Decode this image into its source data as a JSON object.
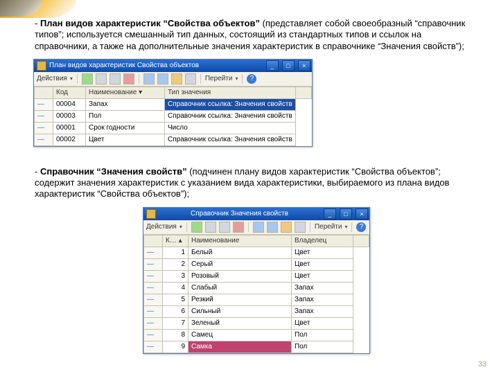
{
  "slide": {
    "para1_bold": "План видов характеристик “Свойства объектов”",
    "para1_rest": " (представляет собой своеобразный “справочник типов”; используется смешанный тип данных, состоящий из стандартных типов и ссылок на справочники, а также на дополнительные значения характеристик в справочнике “Значения свойств”);",
    "para2_bold": "Справочник “Значения свойств”",
    "para2_rest": " (подчинен плану видов характеристик “Свойства объектов”; содержит значения характеристик с указанием вида характеристики, выбираемого из плана видов характеристик “Свойства объектов”);",
    "page_number": "33"
  },
  "win1": {
    "title": "План видов характеристик Свойства объектов",
    "actions": "Действия",
    "jump": "Перейти",
    "help": "?",
    "cols": {
      "c0": "",
      "c1": "Код",
      "c2": "Наименование",
      "c3": "Тип значения"
    },
    "rows": [
      {
        "mark": "",
        "code": "00004",
        "name": "Запах",
        "type": "Справочник ссылка: Значения свойств",
        "sel": true
      },
      {
        "mark": "",
        "code": "00003",
        "name": "Пол",
        "type": "Справочник ссылка: Значения свойств"
      },
      {
        "mark": "",
        "code": "00001",
        "name": "Срок годности",
        "type": "Число"
      },
      {
        "mark": "",
        "code": "00002",
        "name": "Цвет",
        "type": "Справочник ссылка: Значения свойств"
      }
    ]
  },
  "win2": {
    "title": "Справочник Значения свойств",
    "actions": "Действия",
    "jump": "Перейти",
    "help": "?",
    "cols": {
      "c0": "",
      "c1": "К…",
      "c2": "Наименование",
      "c3": "Владелец"
    },
    "rows": [
      {
        "code": "1",
        "name": "Белый",
        "owner": "Цвет"
      },
      {
        "code": "2",
        "name": "Серый",
        "owner": "Цвет"
      },
      {
        "code": "3",
        "name": "Розовый",
        "owner": "Цвет"
      },
      {
        "code": "4",
        "name": "Слабый",
        "owner": "Запах"
      },
      {
        "code": "5",
        "name": "Резкий",
        "owner": "Запах"
      },
      {
        "code": "6",
        "name": "Сильный",
        "owner": "Запах"
      },
      {
        "code": "7",
        "name": "Зеленый",
        "owner": "Цвет"
      },
      {
        "code": "8",
        "name": "Самец",
        "owner": "Пол"
      },
      {
        "code": "9",
        "name": "Самка",
        "owner": "Пол",
        "sel": true
      }
    ]
  }
}
